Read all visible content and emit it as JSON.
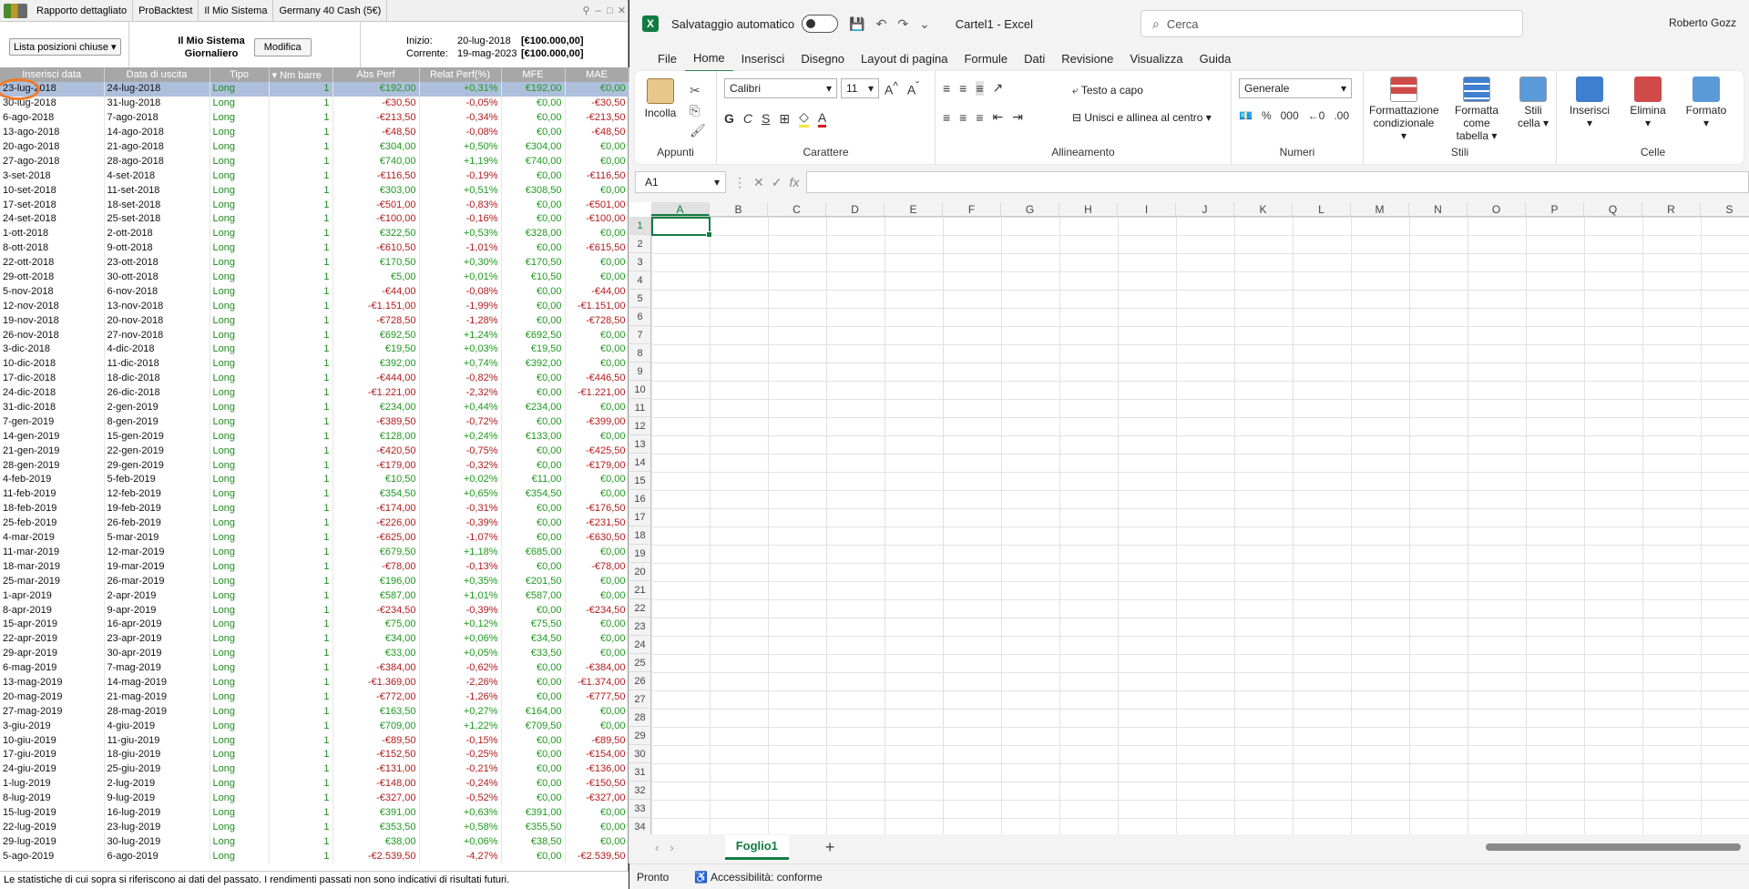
{
  "prt": {
    "tabs": [
      "Rapporto dettagliato",
      "ProBacktest",
      "Il Mio Sistema",
      "Germany 40 Cash (5€)"
    ],
    "list_dropdown": "Lista posizioni chiuse",
    "system_name_line1": "Il Mio Sistema",
    "system_name_line2": "Giornaliero",
    "modify_button": "Modifica",
    "start_label": "Inizio:",
    "start_date": "20-lug-2018",
    "start_capital": "[€100.000,00]",
    "current_label": "Corrente:",
    "current_date": "19-mag-2023",
    "current_capital": "[€100.000,00]",
    "columns": [
      "Inserisci data",
      "Data di uscita",
      "Tipo",
      "Nm barre",
      "Abs Perf",
      "Relat Perf(%)",
      "MFE",
      "MAE"
    ],
    "rows": [
      [
        "23-lug-2018",
        "24-lug-2018",
        "Long",
        "1",
        "€192,00",
        "+0,31%",
        "€192,00",
        "€0,00"
      ],
      [
        "30-lug-2018",
        "31-lug-2018",
        "Long",
        "1",
        "-€30,50",
        "-0,05%",
        "€0,00",
        "-€30,50"
      ],
      [
        "6-ago-2018",
        "7-ago-2018",
        "Long",
        "1",
        "-€213,50",
        "-0,34%",
        "€0,00",
        "-€213,50"
      ],
      [
        "13-ago-2018",
        "14-ago-2018",
        "Long",
        "1",
        "-€48,50",
        "-0,08%",
        "€0,00",
        "-€48,50"
      ],
      [
        "20-ago-2018",
        "21-ago-2018",
        "Long",
        "1",
        "€304,00",
        "+0,50%",
        "€304,00",
        "€0,00"
      ],
      [
        "27-ago-2018",
        "28-ago-2018",
        "Long",
        "1",
        "€740,00",
        "+1,19%",
        "€740,00",
        "€0,00"
      ],
      [
        "3-set-2018",
        "4-set-2018",
        "Long",
        "1",
        "-€116,50",
        "-0,19%",
        "€0,00",
        "-€116,50"
      ],
      [
        "10-set-2018",
        "11-set-2018",
        "Long",
        "1",
        "€303,00",
        "+0,51%",
        "€308,50",
        "€0,00"
      ],
      [
        "17-set-2018",
        "18-set-2018",
        "Long",
        "1",
        "-€501,00",
        "-0,83%",
        "€0,00",
        "-€501,00"
      ],
      [
        "24-set-2018",
        "25-set-2018",
        "Long",
        "1",
        "-€100,00",
        "-0,16%",
        "€0,00",
        "-€100,00"
      ],
      [
        "1-ott-2018",
        "2-ott-2018",
        "Long",
        "1",
        "€322,50",
        "+0,53%",
        "€328,00",
        "€0,00"
      ],
      [
        "8-ott-2018",
        "9-ott-2018",
        "Long",
        "1",
        "-€610,50",
        "-1,01%",
        "€0,00",
        "-€615,50"
      ],
      [
        "22-ott-2018",
        "23-ott-2018",
        "Long",
        "1",
        "€170,50",
        "+0,30%",
        "€170,50",
        "€0,00"
      ],
      [
        "29-ott-2018",
        "30-ott-2018",
        "Long",
        "1",
        "€5,00",
        "+0,01%",
        "€10,50",
        "€0,00"
      ],
      [
        "5-nov-2018",
        "6-nov-2018",
        "Long",
        "1",
        "-€44,00",
        "-0,08%",
        "€0,00",
        "-€44,00"
      ],
      [
        "12-nov-2018",
        "13-nov-2018",
        "Long",
        "1",
        "-€1.151,00",
        "-1,99%",
        "€0,00",
        "-€1.151,00"
      ],
      [
        "19-nov-2018",
        "20-nov-2018",
        "Long",
        "1",
        "-€728,50",
        "-1,28%",
        "€0,00",
        "-€728,50"
      ],
      [
        "26-nov-2018",
        "27-nov-2018",
        "Long",
        "1",
        "€692,50",
        "+1,24%",
        "€692,50",
        "€0,00"
      ],
      [
        "3-dic-2018",
        "4-dic-2018",
        "Long",
        "1",
        "€19,50",
        "+0,03%",
        "€19,50",
        "€0,00"
      ],
      [
        "10-dic-2018",
        "11-dic-2018",
        "Long",
        "1",
        "€392,00",
        "+0,74%",
        "€392,00",
        "€0,00"
      ],
      [
        "17-dic-2018",
        "18-dic-2018",
        "Long",
        "1",
        "-€444,00",
        "-0,82%",
        "€0,00",
        "-€446,50"
      ],
      [
        "24-dic-2018",
        "26-dic-2018",
        "Long",
        "1",
        "-€1.221,00",
        "-2,32%",
        "€0,00",
        "-€1.221,00"
      ],
      [
        "31-dic-2018",
        "2-gen-2019",
        "Long",
        "1",
        "€234,00",
        "+0,44%",
        "€234,00",
        "€0,00"
      ],
      [
        "7-gen-2019",
        "8-gen-2019",
        "Long",
        "1",
        "-€389,50",
        "-0,72%",
        "€0,00",
        "-€399,00"
      ],
      [
        "14-gen-2019",
        "15-gen-2019",
        "Long",
        "1",
        "€128,00",
        "+0,24%",
        "€133,00",
        "€0,00"
      ],
      [
        "21-gen-2019",
        "22-gen-2019",
        "Long",
        "1",
        "-€420,50",
        "-0,75%",
        "€0,00",
        "-€425,50"
      ],
      [
        "28-gen-2019",
        "29-gen-2019",
        "Long",
        "1",
        "-€179,00",
        "-0,32%",
        "€0,00",
        "-€179,00"
      ],
      [
        "4-feb-2019",
        "5-feb-2019",
        "Long",
        "1",
        "€10,50",
        "+0,02%",
        "€11,00",
        "€0,00"
      ],
      [
        "11-feb-2019",
        "12-feb-2019",
        "Long",
        "1",
        "€354,50",
        "+0,65%",
        "€354,50",
        "€0,00"
      ],
      [
        "18-feb-2019",
        "19-feb-2019",
        "Long",
        "1",
        "-€174,00",
        "-0,31%",
        "€0,00",
        "-€176,50"
      ],
      [
        "25-feb-2019",
        "26-feb-2019",
        "Long",
        "1",
        "-€226,00",
        "-0,39%",
        "€0,00",
        "-€231,50"
      ],
      [
        "4-mar-2019",
        "5-mar-2019",
        "Long",
        "1",
        "-€625,00",
        "-1,07%",
        "€0,00",
        "-€630,50"
      ],
      [
        "11-mar-2019",
        "12-mar-2019",
        "Long",
        "1",
        "€679,50",
        "+1,18%",
        "€685,00",
        "€0,00"
      ],
      [
        "18-mar-2019",
        "19-mar-2019",
        "Long",
        "1",
        "-€78,00",
        "-0,13%",
        "€0,00",
        "-€78,00"
      ],
      [
        "25-mar-2019",
        "26-mar-2019",
        "Long",
        "1",
        "€196,00",
        "+0,35%",
        "€201,50",
        "€0,00"
      ],
      [
        "1-apr-2019",
        "2-apr-2019",
        "Long",
        "1",
        "€587,00",
        "+1,01%",
        "€587,00",
        "€0,00"
      ],
      [
        "8-apr-2019",
        "9-apr-2019",
        "Long",
        "1",
        "-€234,50",
        "-0,39%",
        "€0,00",
        "-€234,50"
      ],
      [
        "15-apr-2019",
        "16-apr-2019",
        "Long",
        "1",
        "€75,00",
        "+0,12%",
        "€75,50",
        "€0,00"
      ],
      [
        "22-apr-2019",
        "23-apr-2019",
        "Long",
        "1",
        "€34,00",
        "+0,06%",
        "€34,50",
        "€0,00"
      ],
      [
        "29-apr-2019",
        "30-apr-2019",
        "Long",
        "1",
        "€33,00",
        "+0,05%",
        "€33,50",
        "€0,00"
      ],
      [
        "6-mag-2019",
        "7-mag-2019",
        "Long",
        "1",
        "-€384,00",
        "-0,62%",
        "€0,00",
        "-€384,00"
      ],
      [
        "13-mag-2019",
        "14-mag-2019",
        "Long",
        "1",
        "-€1.369,00",
        "-2,26%",
        "€0,00",
        "-€1.374,00"
      ],
      [
        "20-mag-2019",
        "21-mag-2019",
        "Long",
        "1",
        "-€772,00",
        "-1,26%",
        "€0,00",
        "-€777,50"
      ],
      [
        "27-mag-2019",
        "28-mag-2019",
        "Long",
        "1",
        "€163,50",
        "+0,27%",
        "€164,00",
        "€0,00"
      ],
      [
        "3-giu-2019",
        "4-giu-2019",
        "Long",
        "1",
        "€709,00",
        "+1,22%",
        "€709,50",
        "€0,00"
      ],
      [
        "10-giu-2019",
        "11-giu-2019",
        "Long",
        "1",
        "-€89,50",
        "-0,15%",
        "€0,00",
        "-€89,50"
      ],
      [
        "17-giu-2019",
        "18-giu-2019",
        "Long",
        "1",
        "-€152,50",
        "-0,25%",
        "€0,00",
        "-€154,00"
      ],
      [
        "24-giu-2019",
        "25-giu-2019",
        "Long",
        "1",
        "-€131,00",
        "-0,21%",
        "€0,00",
        "-€136,00"
      ],
      [
        "1-lug-2019",
        "2-lug-2019",
        "Long",
        "1",
        "-€148,00",
        "-0,24%",
        "€0,00",
        "-€150,50"
      ],
      [
        "8-lug-2019",
        "9-lug-2019",
        "Long",
        "1",
        "-€327,00",
        "-0,52%",
        "€0,00",
        "-€327,00"
      ],
      [
        "15-lug-2019",
        "16-lug-2019",
        "Long",
        "1",
        "€391,00",
        "+0,63%",
        "€391,00",
        "€0,00"
      ],
      [
        "22-lug-2019",
        "23-lug-2019",
        "Long",
        "1",
        "€353,50",
        "+0,58%",
        "€355,50",
        "€0,00"
      ],
      [
        "29-lug-2019",
        "30-lug-2019",
        "Long",
        "1",
        "€38,00",
        "+0,06%",
        "€38,50",
        "€0,00"
      ],
      [
        "5-ago-2019",
        "6-ago-2019",
        "Long",
        "1",
        "-€2.539,50",
        "-4,27%",
        "€0,00",
        "-€2.539,50"
      ]
    ],
    "footer": "Le statistiche di cui sopra si riferiscono ai dati del passato. I rendimenti passati non sono indicativi di risultati futuri."
  },
  "excel": {
    "autosave_label": "Salvataggio automatico",
    "doc_title": "Cartel1 - Excel",
    "search_placeholder": "Cerca",
    "user": "Roberto Gozz",
    "menu": [
      "File",
      "Home",
      "Inserisci",
      "Disegno",
      "Layout di pagina",
      "Formule",
      "Dati",
      "Revisione",
      "Visualizza",
      "Guida"
    ],
    "ribbon": {
      "paste": "Incolla",
      "clipboard_group": "Appunti",
      "font_name": "Calibri",
      "font_size": "11",
      "font_group": "Carattere",
      "wrap_text": "Testo a capo",
      "merge_center": "Unisci e allinea al centro",
      "alignment_group": "Allineamento",
      "number_format": "Generale",
      "number_group": "Numeri",
      "cond_format_1": "Formattazione",
      "cond_format_2": "condizionale",
      "format_table_1": "Formatta come",
      "format_table_2": "tabella",
      "cell_styles_1": "Stili",
      "cell_styles_2": "cella",
      "styles_group": "Stili",
      "insert": "Inserisci",
      "delete": "Elimina",
      "format": "Formato",
      "cells_group": "Celle",
      "bold": "G",
      "italic": "C",
      "underline": "S"
    },
    "name_box": "A1",
    "columns": [
      "A",
      "B",
      "C",
      "D",
      "E",
      "F",
      "G",
      "H",
      "I",
      "J",
      "K",
      "L",
      "M",
      "N",
      "O",
      "P",
      "Q",
      "R",
      "S"
    ],
    "rows": [
      "1",
      "2",
      "3",
      "4",
      "5",
      "6",
      "7",
      "8",
      "9",
      "10",
      "11",
      "12",
      "13",
      "14",
      "15",
      "16",
      "17",
      "18",
      "19",
      "20",
      "21",
      "22",
      "23",
      "24",
      "25",
      "26",
      "27",
      "28",
      "29",
      "30",
      "31",
      "32",
      "33",
      "34"
    ],
    "sheet_tab": "Foglio1",
    "status_ready": "Pronto",
    "status_accessibility": "Accessibilità: conforme",
    "accent_color": "#107c41"
  }
}
